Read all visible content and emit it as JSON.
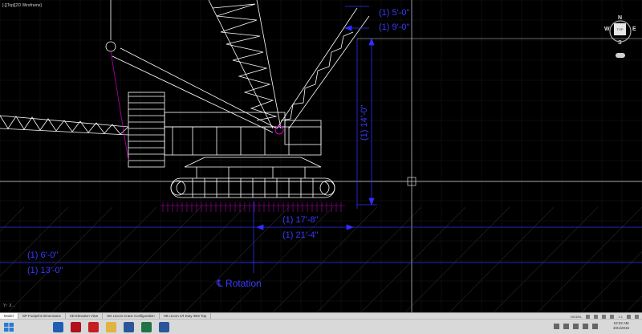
{
  "viewport": {
    "label": "[-][Top][2D Wireframe]"
  },
  "dimensions": [
    {
      "id": "dim_top_right",
      "text": "(1) 5'-0\""
    },
    {
      "id": "dim_top_right_2",
      "text": "(1) 9'-0\""
    },
    {
      "id": "dim_vertical",
      "text": "(1) 14'-0\""
    },
    {
      "id": "dim_track_width",
      "text": "(1) 17'-8\""
    },
    {
      "id": "dim_track_width_2",
      "text": "(1) 21'-4\""
    },
    {
      "id": "dim_bottom_left",
      "text": "(1) 6'-0\""
    },
    {
      "id": "dim_bottom_left_2",
      "text": "(1) 13'-0\""
    },
    {
      "id": "centerline_label",
      "text": "℄ Rotation"
    }
  ],
  "view_cube": {
    "north": "N",
    "south": "S",
    "east": "E",
    "west": "W",
    "face": "TOP"
  },
  "layout_tabs": [
    {
      "label": "Model",
      "active": true
    },
    {
      "label": "GP Footprint Dimensions",
      "active": false
    },
    {
      "label": "HD Elevation View",
      "active": false
    },
    {
      "label": "HD Liccon Crane Configuration",
      "active": false
    },
    {
      "label": "H9 Liccon LR Duty 39m Top",
      "active": false
    }
  ],
  "status": {
    "model_label": "MODEL",
    "scale": "1:1"
  },
  "taskbar": {
    "apps": [
      {
        "name": "outlook",
        "color": "#1e5fb4"
      },
      {
        "name": "acrobat",
        "color": "#b3101d"
      },
      {
        "name": "autocad",
        "color": "#c41e1e"
      },
      {
        "name": "explorer",
        "color": "#e0b443"
      },
      {
        "name": "word",
        "color": "#2b579a"
      },
      {
        "name": "excel",
        "color": "#217346"
      },
      {
        "name": "word2",
        "color": "#2b579a"
      }
    ],
    "time": "10:22 AM",
    "date": "3/21/2015"
  },
  "colors": {
    "background": "#000000",
    "grid": "#1b1b1b",
    "dimension": "#2f2fff",
    "crane": "#ffffff",
    "accent": "#b000b0"
  }
}
